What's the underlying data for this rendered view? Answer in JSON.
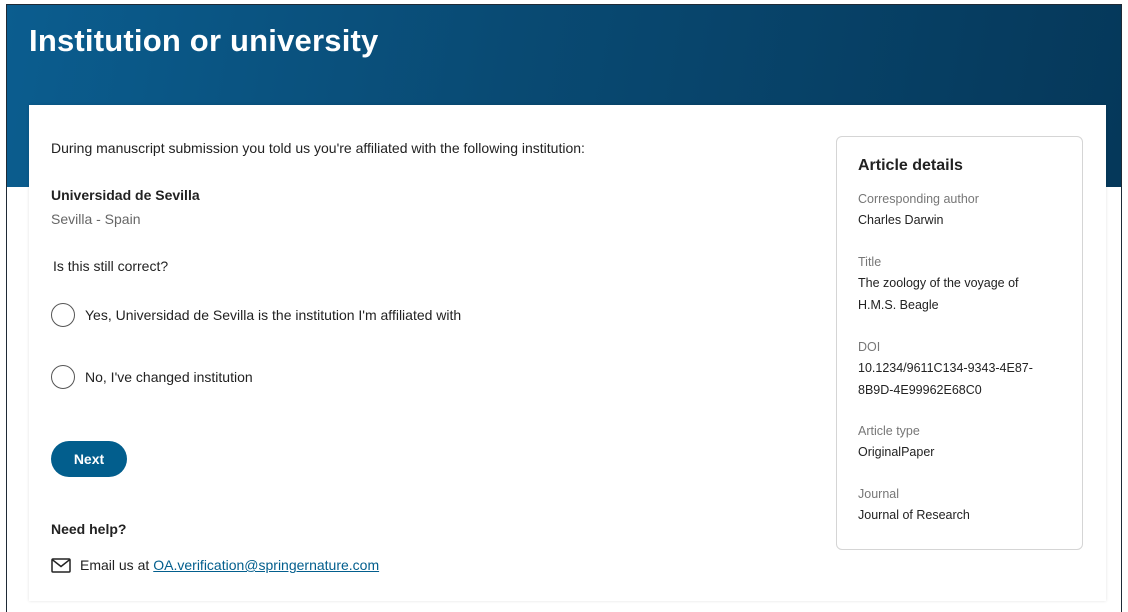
{
  "header": {
    "title": "Institution or university"
  },
  "main": {
    "intro": "During manuscript submission you told us you're affiliated with the following institution:",
    "institution_name": "Universidad de Sevilla",
    "institution_location": "Sevilla - Spain",
    "question": "Is this still correct?",
    "options": [
      {
        "label": "Yes, Universidad de Sevilla is the institution I'm affiliated with",
        "selected": false
      },
      {
        "label": "No, I've changed institution",
        "selected": false
      }
    ],
    "next_label": "Next",
    "help_heading": "Need help?",
    "email_prefix": "Email us at",
    "email_address": "OA.verification@springernature.com",
    "email_icon": "envelope-icon"
  },
  "article_details": {
    "title": "Article details",
    "corresponding_author_label": "Corresponding author",
    "corresponding_author": "Charles Darwin",
    "title_label": "Title",
    "title_value_line1": "The zoology of the voyage of",
    "title_value_line2": "H.M.S. Beagle",
    "doi_label": "DOI",
    "doi_line1": "10.1234/9611C134-9343-4E87-",
    "doi_line2": "8B9D-4E99962E68C0",
    "article_type_label": "Article type",
    "article_type": "OriginalPaper",
    "journal_label": "Journal",
    "journal": "Journal of Research"
  },
  "colors": {
    "header_gradient_start": "#0b5d8f",
    "header_gradient_end": "#05385a",
    "primary_button": "#025e8d",
    "link": "#025e8d"
  }
}
